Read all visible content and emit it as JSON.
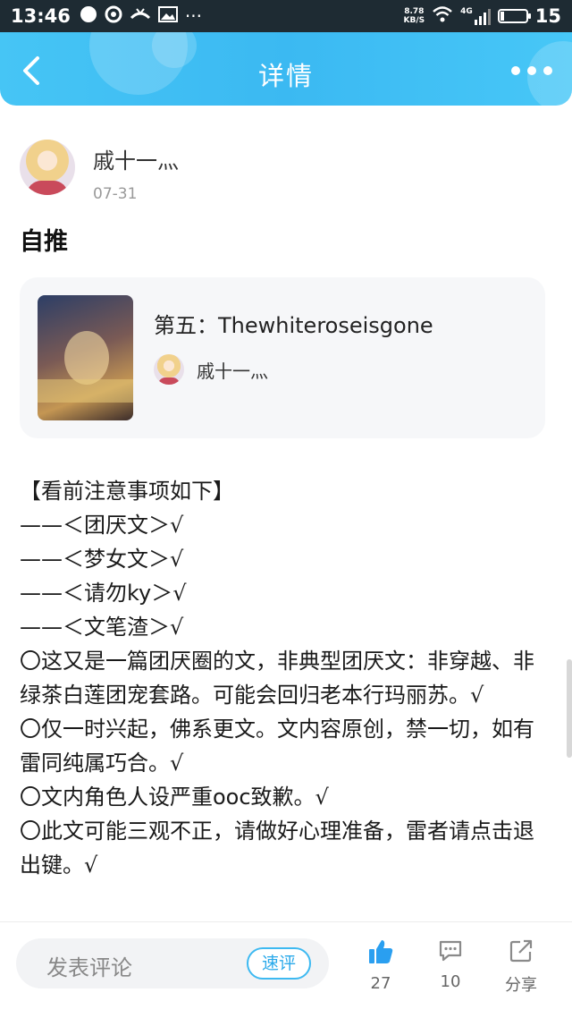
{
  "status_bar": {
    "time": "13:46",
    "speed_value": "8.78",
    "speed_unit": "KB/S",
    "network": "4G",
    "battery_level": "15"
  },
  "nav": {
    "title": "详情"
  },
  "post": {
    "author_name": "戚十一灬",
    "date": "07-31",
    "title": "自推",
    "work_card": {
      "title": "第五：Thewhiteroseisgone",
      "author_name": "戚十一灬"
    },
    "content_lines": [
      "【看前注意事项如下】",
      "——＜团厌文＞√",
      "——＜梦女文＞√",
      "——＜请勿ky＞√",
      "——＜文笔渣＞√",
      "〇这又是一篇团厌圈的文，非典型团厌文：非穿越、非绿茶白莲团宠套路。可能会回归老本行玛丽苏。√",
      "〇仅一时兴起，佛系更文。文内容原创，禁一切，如有雷同纯属巧合。√",
      "〇文内角色人设严重ooc致歉。√",
      "〇此文可能三观不正，请做好心理准备，雷者请点击退出键。√"
    ]
  },
  "bottom_bar": {
    "comment_placeholder": "发表评论",
    "quick_comment_label": "速评",
    "like_count": "27",
    "comment_count": "10",
    "share_label": "分享"
  },
  "colors": {
    "accent": "#3bb9f2",
    "like_blue": "#2a9ff0"
  },
  "icons": [
    "back-arrow-icon",
    "more-dots-icon",
    "thumbs-up-icon",
    "comment-bubble-icon",
    "share-icon",
    "wifi-icon",
    "signal-icon",
    "battery-icon"
  ]
}
